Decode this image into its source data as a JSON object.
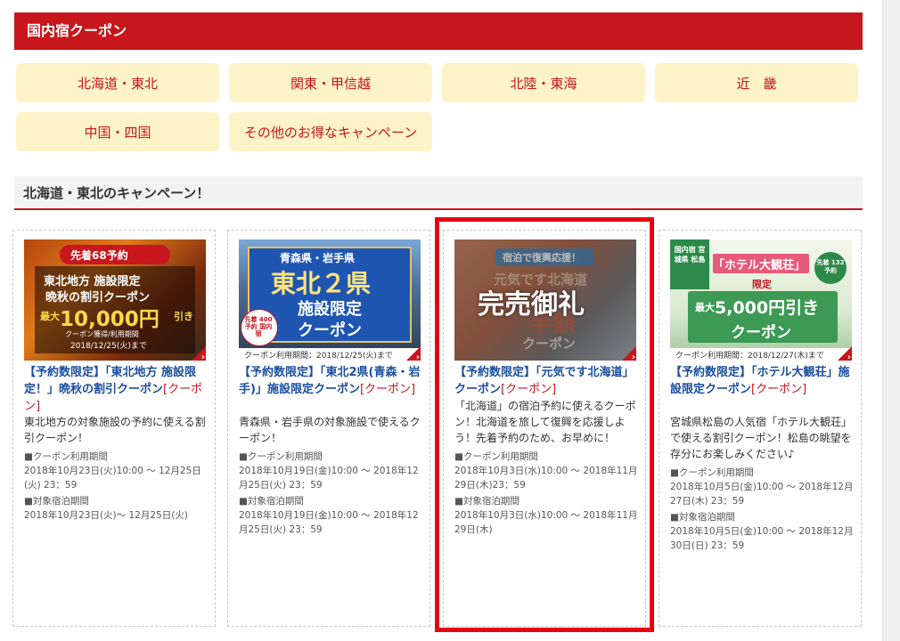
{
  "header": {
    "title": "国内宿クーポン"
  },
  "regions": [
    "北海道・東北",
    "関東・甲信越",
    "北陸・東海",
    "近　畿",
    "中国・四国",
    "その他のお得なキャンペーン"
  ],
  "section": {
    "title": "北海道・東北のキャンペーン！"
  },
  "cards": [
    {
      "banner": {
        "badge": "先着68予約",
        "line1": "東北地方 施設限定",
        "line2": "晩秋の割引クーポン",
        "amount_prefix": "最大",
        "amount": "10,000円",
        "amount_suffix": "引き",
        "period": "クーポン獲得/利用期間",
        "date": "2018/12/25(火)まで"
      },
      "title": "【予約数限定】「東北地方 施設限定！」晩秋の割引クーポン",
      "tag": "[クーポン]",
      "desc": "東北地方の対象施設の予約に使える割引クーポン！",
      "use_label": "■クーポン利用期間",
      "use_period": "2018年10月23日(火)10:00 ～ 12月25日(火) 23：59",
      "stay_label": "■対象宿泊期間",
      "stay_period": "2018年10月23日(火)～ 12月25日(火)"
    },
    {
      "banner": {
        "line1": "青森県・岩手県",
        "line2": "東北２県",
        "line3": "施設限定",
        "line4": "クーポン",
        "badge": "先着 400予約 国内宿",
        "period": "クーポン利用期間：2018/12/25(火)まで"
      },
      "title": "【予約数限定】「東北2県(青森・岩手)」施設限定クーポン",
      "tag": "[クーポン]",
      "desc": "青森県・岩手県の対象施設で使えるクーポン！",
      "use_label": "■クーポン利用期間",
      "use_period": "2018年10月19日(金)10:00 ～ 2018年12月25日(火) 23：59",
      "stay_label": "■対象宿泊期間",
      "stay_period": "2018年10月19日(金)10:00 ～ 2018年12月25日(火) 23：59"
    },
    {
      "banner": {
        "line1": "宿泊で復興応援！",
        "line2": "元気です北海道",
        "line3": "半額",
        "line4": "クーポン",
        "soldout": "完売御礼"
      },
      "title": "【予約数限定】「元気です北海道」クーポン",
      "tag": "[クーポン]",
      "desc": "「北海道」の宿泊予約に使えるクーポン！北海道を旅して復興を応援しよう！先着予約のため、お早めに！",
      "use_label": "■クーポン利用期間",
      "use_period": "2018年10月3日(水)10:00 ～ 2018年11月29日(木)23：59",
      "stay_label": "■対象宿泊期間",
      "stay_period": "2018年10月3日(水)10:00 ～ 2018年11月29日(木)"
    },
    {
      "banner": {
        "area": "国内宿 宮城県 松島",
        "hotel": "「ホテル大観荘」",
        "limited": "限定",
        "badge": "先着 132予約",
        "amount_prefix": "最大",
        "amount": "5,000円引き",
        "coupon": "クーポン",
        "period": "クーポン利用期間：2018/12/27(木)まで"
      },
      "title": "【予約数限定】「ホテル大観荘」施設限定クーポン",
      "tag": "[クーポン]",
      "desc": "宮城県松島の人気宿「ホテル大観荘」で使える割引クーポン！松島の眺望を存分にお楽しみください♪",
      "use_label": "■クーポン利用期間",
      "use_period": "2018年10月5日(金)10:00 ～ 2018年12月27日(木) 23：59",
      "stay_label": "■対象宿泊期間",
      "stay_period": "2018年10月5日(金)10:00 ～ 2018年12月30日(日) 23：59"
    }
  ],
  "colors": {
    "brand_red": "#c8161d",
    "button_bg": "#fdf3c8",
    "link_blue": "#1a4e9e",
    "highlight": "#e60012"
  }
}
